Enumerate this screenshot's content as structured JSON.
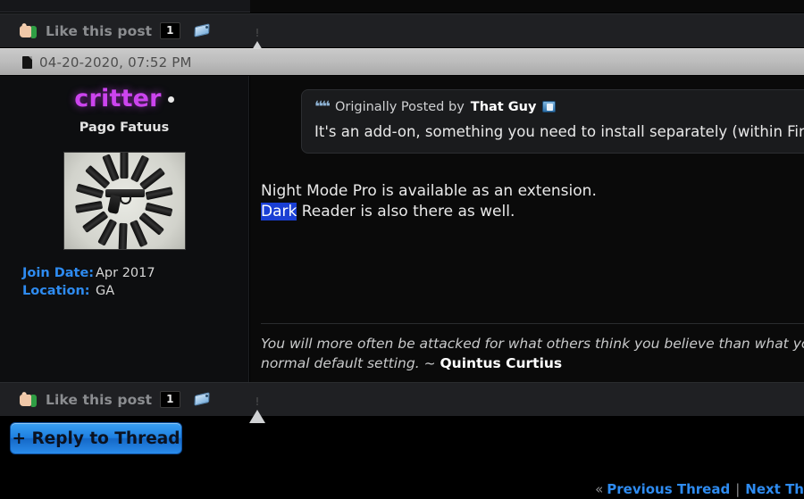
{
  "actions_top": {
    "like_label": "Like this post",
    "like_count": "1",
    "thumb_icon": "thumbs-up-icon",
    "tag_icon": "tag-icon",
    "report_icon": "report-warning-icon"
  },
  "actions_bottom": {
    "like_label": "Like this post",
    "like_count": "1",
    "thumb_icon": "thumbs-up-icon",
    "tag_icon": "tag-icon",
    "report_icon": "report-warning-icon"
  },
  "post": {
    "date": "04-20-2020, 07:52 PM",
    "date_icon": "post-page-icon",
    "username": "critter",
    "username_color": "#cc44ee",
    "online_status": "online",
    "user_title": "Pago Fatuus",
    "avatar_alt": "pistol surrounded by magazines",
    "stats": [
      {
        "label": "Join Date:",
        "value": "Apr 2017"
      },
      {
        "label": "Location:",
        "value": "GA"
      }
    ],
    "quote": {
      "prefix": "Originally Posted by",
      "author": "That Guy",
      "author_badge": "user-badge-icon",
      "quote_icon": "quote-marks-icon",
      "body": "It's an add-on, something you need to install separately (within Firefox)."
    },
    "body_line1": "Night Mode Pro is available as an extension.",
    "body_line2_selected": "Dark",
    "body_line2_rest": " Reader is also there as well.",
    "selection_color": "#1a3fd4",
    "signature_line1": "You will more often be attacked for what others think you believe than what yo",
    "signature_line2_text": "normal default setting. ~ ",
    "signature_attribution": "Quintus Curtius"
  },
  "reply": {
    "label": "+ Reply to Thread",
    "accent": "#1e7fe0"
  },
  "bottom_nav": {
    "chevron": "«",
    "previous": "Previous Thread",
    "separator": "|",
    "next": "Next Th"
  }
}
